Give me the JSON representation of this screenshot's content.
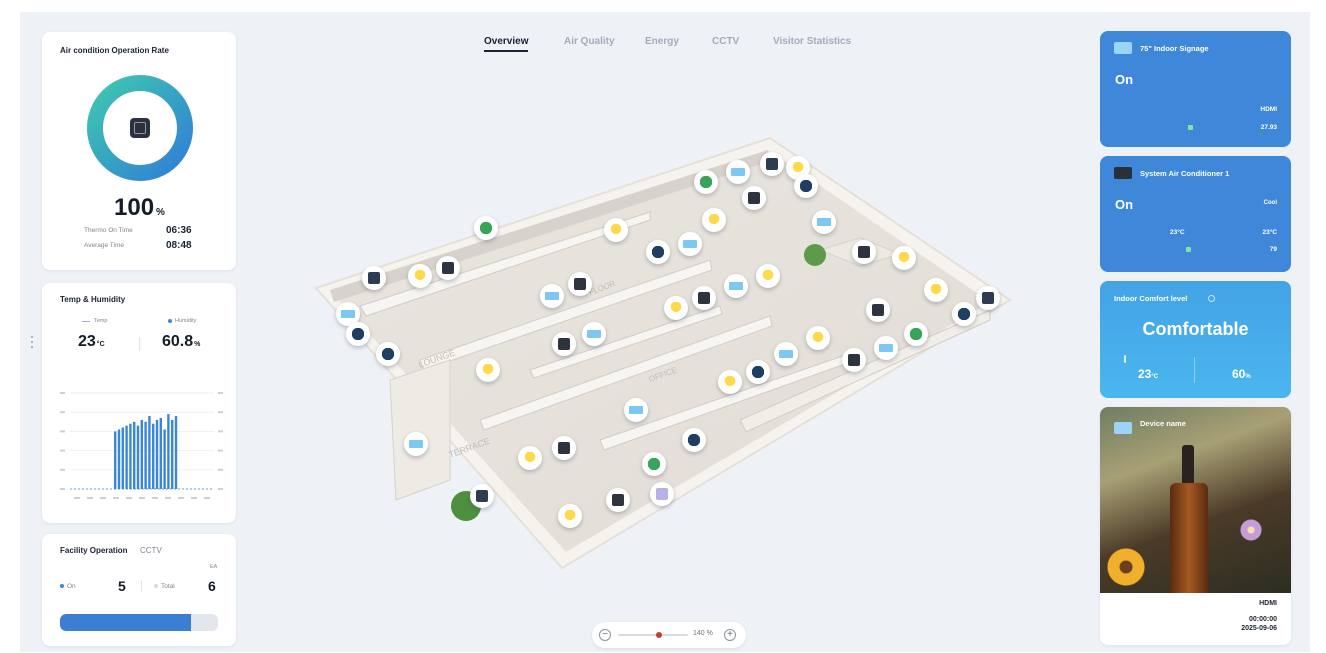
{
  "nav": {
    "tabs": [
      {
        "label": "Overview",
        "active": true
      },
      {
        "label": "Air Quality",
        "active": false
      },
      {
        "label": "Energy",
        "active": false
      },
      {
        "label": "CCTV",
        "active": false
      },
      {
        "label": "Visitor Statistics",
        "active": false
      }
    ]
  },
  "ac_operation": {
    "title": "Air condition Operation Rate",
    "rate_value": "100",
    "rate_unit": "%",
    "rate_fraction": 1.0,
    "thermo_on_label": "Thermo On Time",
    "thermo_on_value": "06:36",
    "average_label": "Average Time",
    "average_value": "08:48",
    "ring_colors": [
      "#2f7fd6",
      "#3fc7b0"
    ]
  },
  "temp_humidity": {
    "title": "Temp & Humidity",
    "temp_label": "Temp",
    "humidity_label": "Humidity",
    "temp_value": "23",
    "temp_unit": "°C",
    "humidity_value": "60.8",
    "humidity_unit": "%"
  },
  "chart_data": {
    "type": "bar",
    "bar_color": "#3a86d8",
    "ylim": [
      0,
      50
    ],
    "values": [
      30,
      31,
      32,
      33,
      34,
      35,
      33,
      36,
      35,
      38,
      34,
      36,
      37,
      31,
      39,
      36,
      38
    ]
  },
  "facility": {
    "title": "Facility Operation",
    "tab_cctv": "CCTV",
    "unit": "EA",
    "on_label": "On",
    "on_value": "5",
    "total_label": "Total",
    "total_value": "6",
    "on_fraction": 0.83
  },
  "signage": {
    "title": "75\" Indoor Signage",
    "state": "On",
    "value_a": "HDMI",
    "value_b": "27.93"
  },
  "system_ac": {
    "title": "System Air Conditioner 1",
    "state": "On",
    "mode": "Cool",
    "set_temp": "23°C",
    "current_temp": "23°C",
    "consumption": "79"
  },
  "comfort": {
    "title": "Indoor Comfort level",
    "state": "Comfortable",
    "temp_value": "23",
    "temp_unit": "°C",
    "humidity_value": "60",
    "humidity_unit": "%"
  },
  "device": {
    "title": "Device name",
    "source_value": "HDMI",
    "time_value": "00:00:00",
    "date_value": "2025-09-06"
  },
  "zoom": {
    "level": "140",
    "unit": "%",
    "fraction": 0.58
  },
  "map_labels": [
    "LOUNGE",
    "TERRACE",
    "OFFICE",
    "FLOOR"
  ]
}
